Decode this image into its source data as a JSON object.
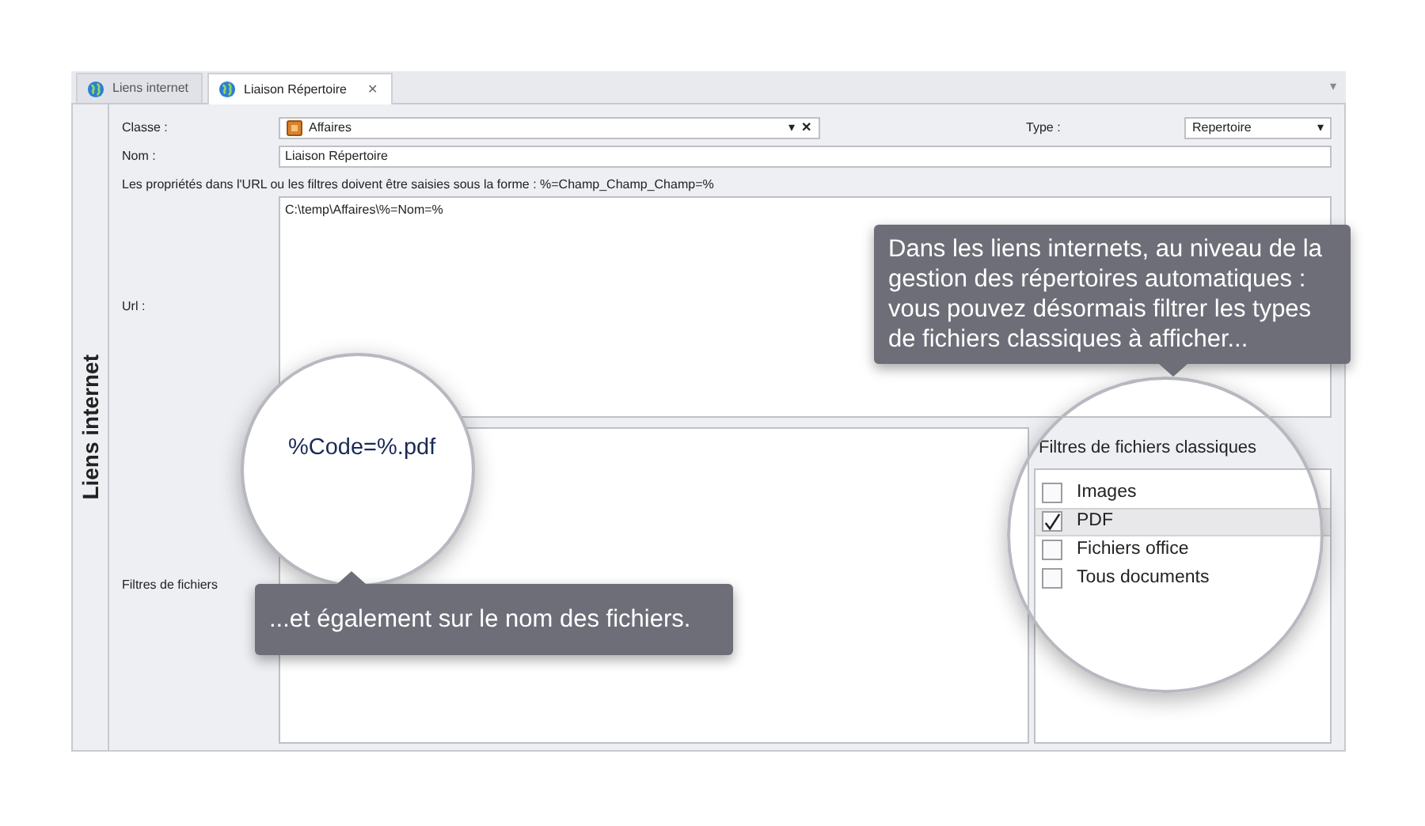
{
  "tabs": [
    {
      "label": "Liens internet",
      "selected": false
    },
    {
      "label": "Liaison Répertoire",
      "selected": true,
      "close": "✕"
    }
  ],
  "side_title": "Liens internet",
  "form": {
    "classe": {
      "label": "Classe :",
      "value": "Affaires",
      "arrow": "▾",
      "clear": "✕"
    },
    "type": {
      "label": "Type :",
      "value": "Repertoire",
      "arrow": "▾"
    },
    "nom": {
      "label": "Nom :",
      "value": "Liaison Répertoire"
    },
    "hint": "Les propriétés dans l'URL ou les filtres doivent être saisies sous la forme : %=Champ_Champ_Champ=%",
    "url": {
      "label": "Url :",
      "value": "C:\\temp\\Affaires\\%=Nom=%"
    },
    "filters": {
      "label": "Filtres de fichiers",
      "value": "%Code=%.pdf"
    },
    "classic": {
      "title": "Filtres de fichiers classiques",
      "items": [
        {
          "label": "Images",
          "checked": false,
          "selected": false
        },
        {
          "label": "PDF",
          "checked": true,
          "selected": true
        },
        {
          "label": "Fichiers office",
          "checked": false,
          "selected": false
        },
        {
          "label": "Tous documents",
          "checked": false,
          "selected": false
        }
      ]
    }
  },
  "callouts": [
    {
      "text": "Dans les liens internets, au niveau de la gestion des répertoires automatiques : vous pouvez désormais filtrer les types de fichiers classiques à afficher...",
      "kind": "below"
    },
    {
      "text": "...et également sur le nom des fichiers.",
      "kind": "above"
    }
  ]
}
